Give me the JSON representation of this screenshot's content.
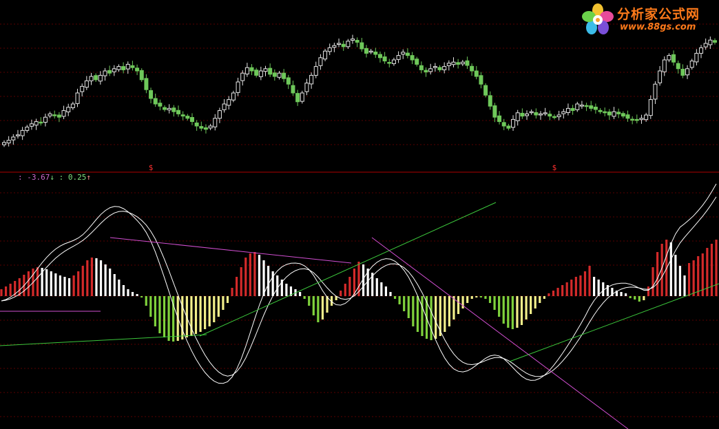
{
  "logo": {
    "cn": "分析家公式网",
    "url": "www.88gs.com"
  },
  "indicator_readout": {
    "v1_prefix": ": ",
    "v1": "-3.67",
    "v1_arrow": "↓",
    "v2_prefix": " : ",
    "v2": "0.25",
    "v2_arrow": "↑"
  },
  "signal_marks": [
    "$",
    "$"
  ],
  "colors": {
    "background": "#000000",
    "grid": "#5a0000",
    "divider": "#b00000",
    "candle": "#6ec85a",
    "bar_red": "#d42a2a",
    "bar_white": "#ffffff",
    "bar_green": "#7fd23c",
    "bar_yellow": "#f2ef8a",
    "trend_green": "#3cc83c",
    "trend_magenta": "#d24fd2",
    "signal": "#ff3030",
    "readout_v1": "#d06ad0",
    "readout_v2": "#7fe07f",
    "logo": "#ff7a1a"
  },
  "chart_data": [
    {
      "type": "candlestick",
      "panel": "price",
      "axes": "none",
      "grid": true,
      "close_series": [
        0.05,
        0.07,
        0.1,
        0.12,
        0.16,
        0.19,
        0.22,
        0.24,
        0.23,
        0.28,
        0.31,
        0.3,
        0.28,
        0.34,
        0.37,
        0.4,
        0.5,
        0.56,
        0.61,
        0.65,
        0.62,
        0.66,
        0.7,
        0.68,
        0.72,
        0.74,
        0.71,
        0.76,
        0.73,
        0.7,
        0.62,
        0.53,
        0.45,
        0.4,
        0.38,
        0.35,
        0.36,
        0.33,
        0.31,
        0.29,
        0.27,
        0.24,
        0.2,
        0.18,
        0.17,
        0.2,
        0.27,
        0.34,
        0.4,
        0.44,
        0.5,
        0.6,
        0.68,
        0.73,
        0.7,
        0.66,
        0.7,
        0.72,
        0.67,
        0.65,
        0.68,
        0.63,
        0.58,
        0.5,
        0.42,
        0.5,
        0.59,
        0.66,
        0.74,
        0.82,
        0.88,
        0.91,
        0.93,
        0.95,
        0.92,
        0.97,
        0.99,
        0.96,
        0.9,
        0.86,
        0.88,
        0.85,
        0.82,
        0.79,
        0.77,
        0.8,
        0.84,
        0.87,
        0.84,
        0.8,
        0.76,
        0.71,
        0.69,
        0.72,
        0.74,
        0.71,
        0.74,
        0.77,
        0.78,
        0.76,
        0.78,
        0.75,
        0.7,
        0.65,
        0.58,
        0.48,
        0.38,
        0.28,
        0.24,
        0.2,
        0.18,
        0.26,
        0.32,
        0.29,
        0.31,
        0.33,
        0.3,
        0.31,
        0.32,
        0.29,
        0.28,
        0.3,
        0.33,
        0.36,
        0.34,
        0.4,
        0.39,
        0.38,
        0.36,
        0.35,
        0.33,
        0.32,
        0.3,
        0.33,
        0.31,
        0.29,
        0.27,
        0.26,
        0.25,
        0.27,
        0.3,
        0.44,
        0.58,
        0.7,
        0.8,
        0.84,
        0.78,
        0.72,
        0.66,
        0.72,
        0.79,
        0.86,
        0.91,
        0.95,
        0.98,
        0.96
      ],
      "signals": [
        {
          "index": 32,
          "label": "$"
        },
        {
          "index": 120,
          "label": "$"
        }
      ]
    },
    {
      "type": "bar",
      "panel": "indicator",
      "axes": "none",
      "grid": true,
      "values": [
        0.1,
        0.14,
        0.18,
        0.22,
        0.26,
        0.31,
        0.36,
        0.4,
        0.42,
        0.41,
        0.39,
        0.36,
        0.33,
        0.3,
        0.28,
        0.26,
        0.3,
        0.36,
        0.44,
        0.52,
        0.56,
        0.55,
        0.52,
        0.46,
        0.4,
        0.32,
        0.24,
        0.16,
        0.1,
        0.06,
        0.03,
        -0.02,
        -0.14,
        -0.3,
        -0.44,
        -0.54,
        -0.6,
        -0.65,
        -0.66,
        -0.65,
        -0.63,
        -0.6,
        -0.58,
        -0.55,
        -0.52,
        -0.48,
        -0.44,
        -0.38,
        -0.3,
        -0.2,
        -0.1,
        0.12,
        0.28,
        0.42,
        0.56,
        0.62,
        0.64,
        0.6,
        0.52,
        0.44,
        0.36,
        0.3,
        0.24,
        0.18,
        0.14,
        0.1,
        0.06,
        -0.04,
        -0.14,
        -0.28,
        -0.38,
        -0.34,
        -0.24,
        -0.14,
        -0.06,
        0.08,
        0.18,
        0.28,
        0.4,
        0.5,
        0.46,
        0.4,
        0.34,
        0.26,
        0.2,
        0.14,
        0.06,
        -0.04,
        -0.12,
        -0.22,
        -0.32,
        -0.44,
        -0.52,
        -0.58,
        -0.62,
        -0.64,
        -0.62,
        -0.58,
        -0.52,
        -0.44,
        -0.34,
        -0.26,
        -0.18,
        -0.1,
        -0.04,
        -0.02,
        -0.02,
        -0.04,
        -0.1,
        -0.2,
        -0.3,
        -0.4,
        -0.46,
        -0.48,
        -0.46,
        -0.42,
        -0.34,
        -0.26,
        -0.18,
        -0.1,
        -0.04,
        0.04,
        0.08,
        0.12,
        0.16,
        0.2,
        0.24,
        0.28,
        0.3,
        0.36,
        0.44,
        0.28,
        0.24,
        0.2,
        0.16,
        0.12,
        0.08,
        0.06,
        0.04,
        -0.03,
        -0.05,
        -0.08,
        -0.06,
        0.14,
        0.42,
        0.64,
        0.76,
        0.82,
        0.78,
        0.6,
        0.44,
        0.3,
        0.48,
        0.52,
        0.58,
        0.62,
        0.7,
        0.76,
        0.82
      ],
      "color_rule": "positive rising = red, positive falling = white, negative falling = green, negative rising = yellow"
    }
  ]
}
